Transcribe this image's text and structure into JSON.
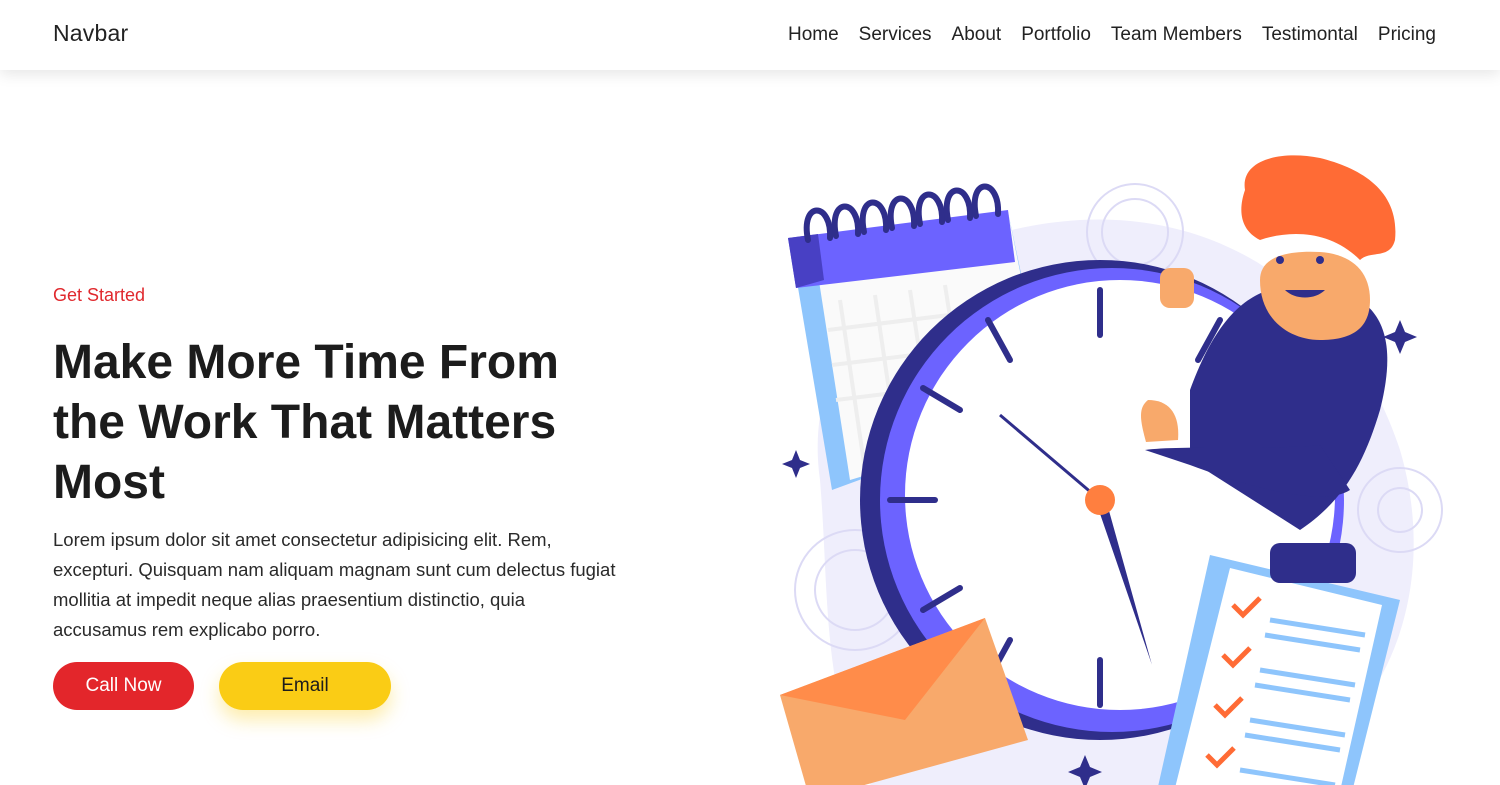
{
  "navbar": {
    "brand": "Navbar",
    "links": [
      "Home",
      "Services",
      "About",
      "Portfolio",
      "Team Members",
      "Testimontal",
      "Pricing"
    ]
  },
  "hero": {
    "eyebrow": "Get Started",
    "headline": "Make More Time From the Work That Matters Most",
    "lead": "Lorem ipsum dolor sit amet consectetur adipisicing elit. Rem, excepturi. Quisquam nam aliquam magnam sunt cum delectus fugiat mollitia at impedit neque alias praesentium distinctio, quia accusamus rem explicabo porro.",
    "call_button": "Call Now",
    "email_button": "Email"
  },
  "colors": {
    "accent_red": "#e3262b",
    "accent_yellow": "#facc15",
    "clock_purple": "#6c63ff",
    "navy": "#2f2e8b"
  },
  "illustration": {
    "icon": "time-management-illustration"
  }
}
